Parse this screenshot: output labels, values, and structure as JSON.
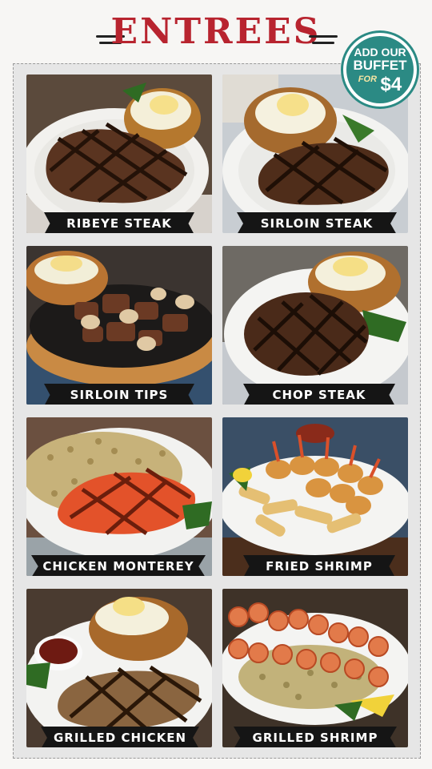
{
  "header": {
    "title": "ENTREES"
  },
  "badge": {
    "line1": "ADD OUR",
    "line2": "BUFFET",
    "for_text": "FOR",
    "price": "$4",
    "color": "#2b8a84"
  },
  "accent_color": "#b8242f",
  "entrees": [
    {
      "name": "RIBEYE STEAK"
    },
    {
      "name": "SIRLOIN STEAK"
    },
    {
      "name": "SIRLOIN TIPS"
    },
    {
      "name": "CHOP STEAK"
    },
    {
      "name": "CHICKEN MONTEREY"
    },
    {
      "name": "FRIED SHRIMP"
    },
    {
      "name": "GRILLED CHICKEN"
    },
    {
      "name": "GRILLED SHRIMP"
    }
  ]
}
